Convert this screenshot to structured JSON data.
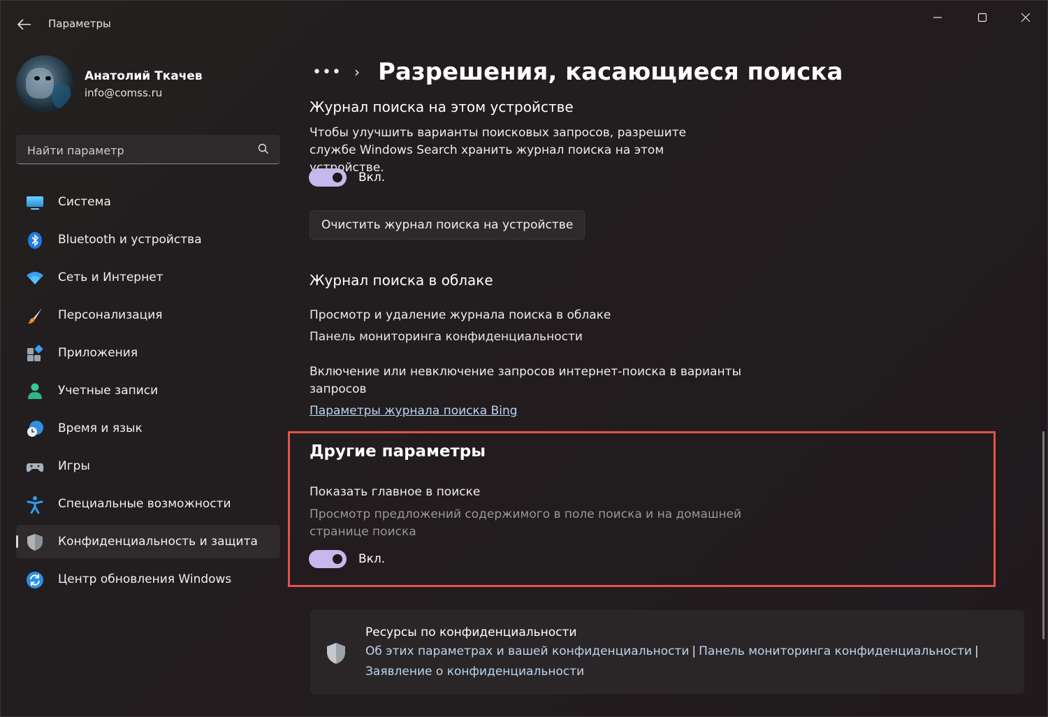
{
  "window": {
    "title": "Параметры",
    "controls": [
      "minimize-icon",
      "maximize-icon",
      "close-icon"
    ]
  },
  "profile": {
    "name": "Анатолий Ткачев",
    "email": "info@comss.ru"
  },
  "search": {
    "placeholder": "Найти параметр",
    "icon": "search-icon"
  },
  "sidebar": {
    "items": [
      {
        "label": "Система",
        "icon": "monitor-icon"
      },
      {
        "label": "Bluetooth и устройства",
        "icon": "bluetooth-icon"
      },
      {
        "label": "Сеть и Интернет",
        "icon": "wifi-icon"
      },
      {
        "label": "Персонализация",
        "icon": "brush-icon"
      },
      {
        "label": "Приложения",
        "icon": "apps-icon"
      },
      {
        "label": "Учетные записи",
        "icon": "person-icon"
      },
      {
        "label": "Время и язык",
        "icon": "clock-globe-icon"
      },
      {
        "label": "Игры",
        "icon": "gamepad-icon"
      },
      {
        "label": "Специальные возможности",
        "icon": "accessibility-icon"
      },
      {
        "label": "Конфиденциальность и защита",
        "icon": "shield-icon",
        "selected": true
      },
      {
        "label": "Центр обновления Windows",
        "icon": "update-icon"
      }
    ],
    "selected_index": 9
  },
  "breadcrumb": {
    "overflow": "•••",
    "separator": "›",
    "title": "Разрешения, касающиеся поиска"
  },
  "device_history": {
    "title": "Журнал поиска на этом устройстве",
    "description": "Чтобы улучшить варианты поисковых запросов, разрешите службе Windows Search хранить журнал поиска на этом устройстве.",
    "toggle_state": "Вкл.",
    "toggle_on": true,
    "clear_button": "Очистить журнал поиска на устройстве"
  },
  "cloud_history": {
    "title": "Журнал поиска в облаке",
    "view_delete_label": "Просмотр и удаление журнала поиска в облаке",
    "dashboard_link": "Панель мониторинга конфиденциальности",
    "include_label": "Включение или невключение запросов интернет-поиска в варианты запросов",
    "bing_link": "Параметры журнала поиска Bing"
  },
  "other": {
    "title": "Другие параметры",
    "highlights_label": "Показать главное в поиске",
    "highlights_desc": "Просмотр предложений содержимого в поле поиска и на домашней странице поиска",
    "toggle_state": "Вкл.",
    "toggle_on": true
  },
  "privacy_resources": {
    "title": "Ресурсы по конфиденциальности",
    "link1": "Об этих параметрах и вашей конфиденциальности",
    "link2": "Панель мониторинга конфиденциальности",
    "link3": "Заявление о конфиденциальности",
    "separator": "|",
    "icon": "shield-icon"
  },
  "colors": {
    "accent_toggle": "#c6b8ec",
    "highlight_border": "#e5534b",
    "link": "#bcd4f0"
  }
}
